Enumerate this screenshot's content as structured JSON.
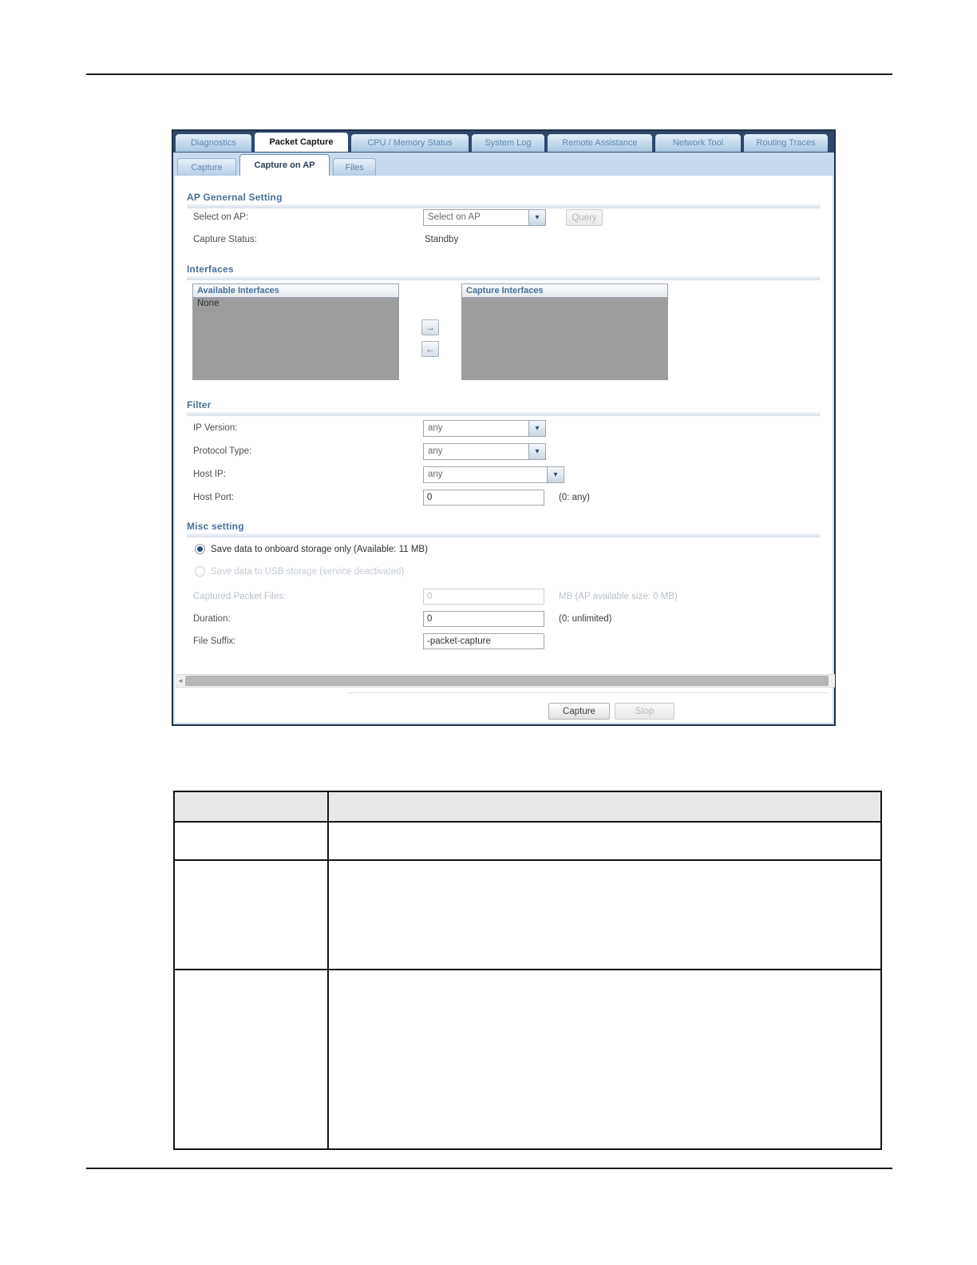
{
  "colors": {
    "tab_strip_navy": "#32486b",
    "inactive_tab_blue": "#5f87ad",
    "subtab_strip_blue": "#c6daec",
    "section_heading_blue": "#4a7097",
    "radio_dot_navy": "#2d4f7a",
    "list_body_gray": "#9d9d9d",
    "table_header_gray": "#e8e8e8"
  },
  "glyphs": {
    "chevron_down": "▾",
    "arrow_right": "→",
    "arrow_left": "←",
    "scroll_left": "◄"
  },
  "shot": {
    "main_tabs": [
      {
        "label": "Diagnostics"
      },
      {
        "label": "Packet Capture"
      },
      {
        "label": "CPU / Memory Status"
      },
      {
        "label": "System Log"
      },
      {
        "label": "Remote Assistance"
      },
      {
        "label": "Network Tool"
      },
      {
        "label": "Routing Traces"
      }
    ],
    "sub_tabs": [
      {
        "label": "Capture"
      },
      {
        "label": "Capture on AP"
      },
      {
        "label": "Files"
      }
    ],
    "ap_general": {
      "title": "AP Genernal Setting",
      "select_ap_label": "Select on AP:",
      "select_ap_value": "Select on AP",
      "query_button": "Query",
      "capture_status_label": "Capture Status:",
      "capture_status_value": "Standby"
    },
    "interfaces": {
      "title": "Interfaces",
      "available_header": "Available Interfaces",
      "available_item": "None",
      "capture_header": "Capture Interfaces"
    },
    "filter": {
      "title": "Filter",
      "ip_version_label": "IP Version:",
      "ip_version_value": "any",
      "protocol_label": "Protocol Type:",
      "protocol_value": "any",
      "host_ip_label": "Host IP:",
      "host_ip_value": "any",
      "host_port_label": "Host Port:",
      "host_port_value": "0",
      "host_port_hint": "(0: any)"
    },
    "misc": {
      "title": "Misc setting",
      "onboard_radio_label": "Save data to onboard storage only (Available: 11 MB)",
      "usb_radio_label": "Save data to USB storage (service deactivated)",
      "captured_label": "Captured Packet Files:",
      "captured_value": "0",
      "captured_hint": "MB (AP available size: 0 MB)",
      "duration_label": "Duration:",
      "duration_value": "0",
      "duration_hint": "(0: unlimited)",
      "suffix_label": "File Suffix:",
      "suffix_value": "-packet-capture"
    },
    "buttons": {
      "capture": "Capture",
      "stop": "Stop"
    }
  }
}
